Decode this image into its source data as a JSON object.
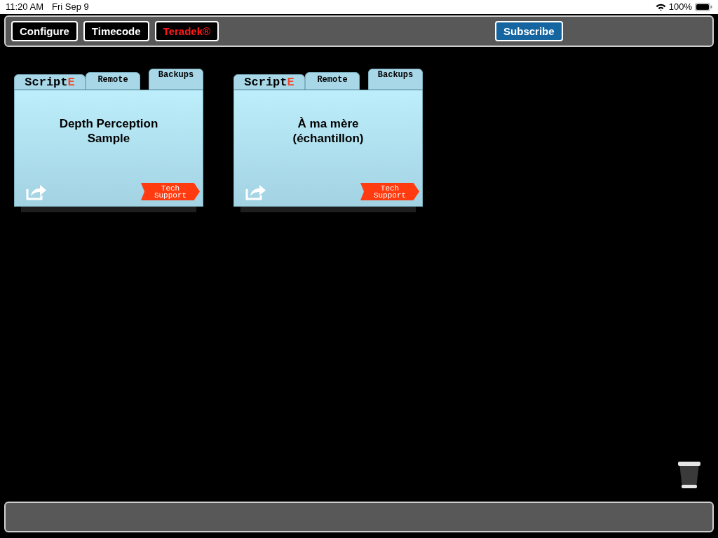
{
  "status_bar": {
    "time": "11:20 AM",
    "date": "Fri Sep 9",
    "battery": "100%"
  },
  "toolbar": {
    "buttons": [
      {
        "label": "Configure",
        "kind": "plain"
      },
      {
        "label": "Timecode",
        "kind": "plain"
      },
      {
        "label": "Teradek®",
        "kind": "teradek"
      },
      {
        "label": "Subscribe",
        "kind": "subscribe"
      }
    ]
  },
  "projects": [
    {
      "logo": "Script",
      "logo_accent": "E",
      "tabs": [
        "Remote",
        "Backups"
      ],
      "title": "Depth Perception\nSample",
      "support": "Tech\nSupport"
    },
    {
      "logo": "Script",
      "logo_accent": "E",
      "tabs": [
        "Remote",
        "Backups"
      ],
      "title": "À ma mère\n(échantillon)",
      "support": "Tech\nSupport"
    }
  ]
}
